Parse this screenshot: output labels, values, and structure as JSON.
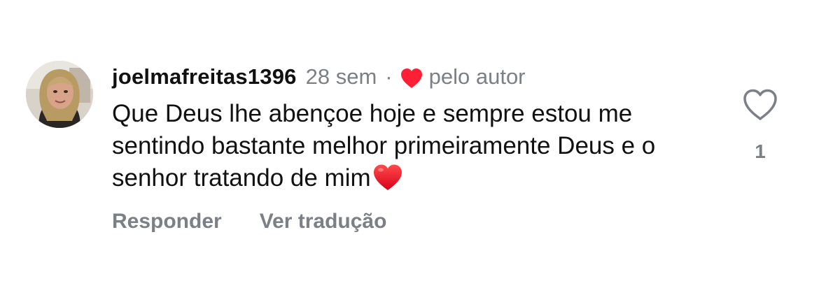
{
  "comment": {
    "username": "joelmafreitas1396",
    "time": "28 sem",
    "separator": "·",
    "author_liked_label": "pelo autor",
    "text": "Que Deus lhe abençoe hoje e sempre estou me sentindo bastante melhor primeiramente Deus e o senhor tratando de mim",
    "text_emoji": "red-heart-emoji",
    "like_icon": "heart-outline-icon",
    "like_count": "1",
    "author_heart_color": "#ff1f35"
  },
  "actions": {
    "reply_label": "Responder",
    "translate_label": "Ver tradução"
  }
}
